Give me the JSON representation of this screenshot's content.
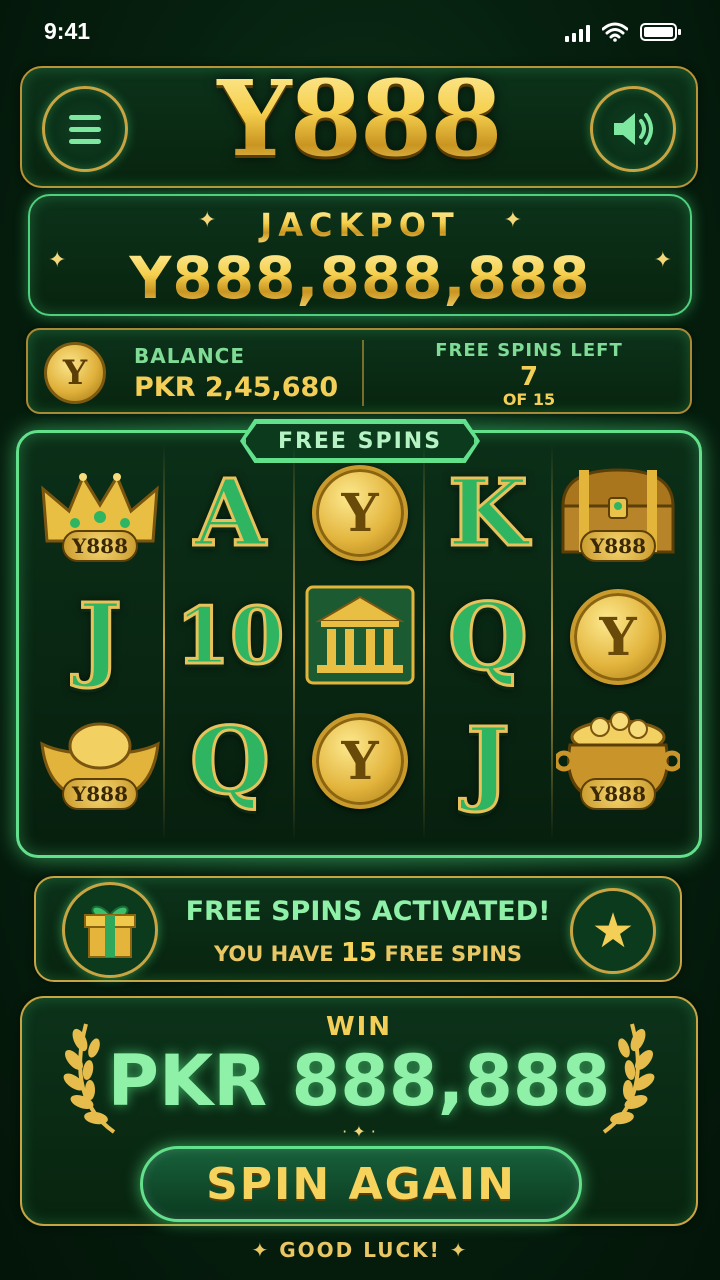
{
  "status_bar": {
    "time": "9:41"
  },
  "header": {
    "logo": "Y888",
    "menu_icon": "menu-icon",
    "sound_icon": "speaker-icon"
  },
  "jackpot": {
    "title": "JACKPOT",
    "value": "Y888,888,888"
  },
  "balance": {
    "label": "BALANCE",
    "value": "PKR 2,45,680",
    "coin_letter": "Y"
  },
  "free_spins_left": {
    "label": "FREE SPINS LEFT",
    "count": "7",
    "of": "OF 15"
  },
  "reels": {
    "banner": "FREE SPINS",
    "tag_text": "Y888",
    "coin_letter": "Y",
    "grid": [
      [
        "crown",
        "A",
        "coin",
        "K",
        "chest"
      ],
      [
        "J",
        "10",
        "temple",
        "Q",
        "coin"
      ],
      [
        "ingot",
        "Q",
        "coin",
        "J",
        "pot"
      ]
    ]
  },
  "activated": {
    "title": "FREE SPINS ACTIVATED!",
    "sub_prefix": "YOU HAVE",
    "sub_count": "15",
    "sub_suffix": "FREE SPINS"
  },
  "win": {
    "label": "WIN",
    "value": "PKR 888,888"
  },
  "spin_button": {
    "label": "SPIN AGAIN"
  },
  "footer": {
    "text": "GOOD LUCK!"
  },
  "colors": {
    "gold": "#f3cf58",
    "green_glow": "#63e08c",
    "background": "#06200f"
  }
}
